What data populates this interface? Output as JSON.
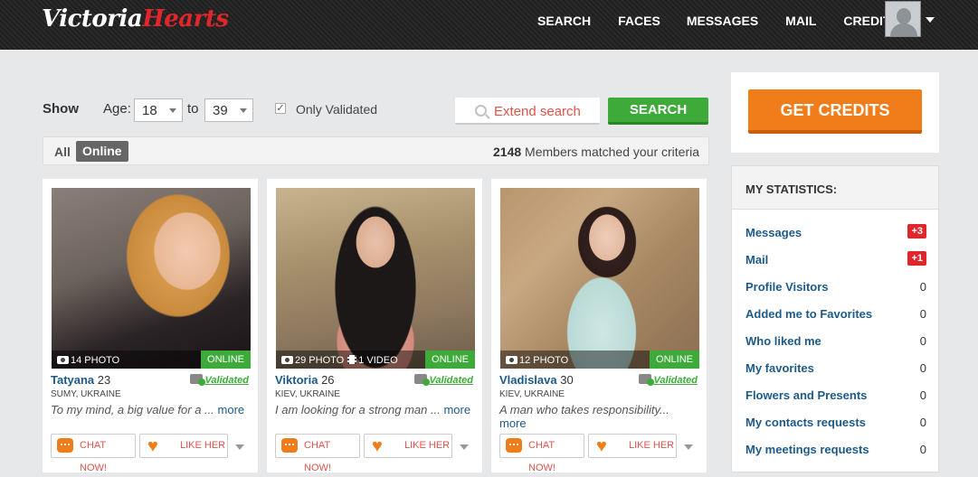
{
  "header": {
    "logo_part1": "Victoria",
    "logo_part2": "Hearts",
    "nav": [
      {
        "label": "SEARCH"
      },
      {
        "label": "FACES"
      },
      {
        "label": "MESSAGES"
      },
      {
        "label": "MAIL"
      },
      {
        "label": "CREDITS"
      }
    ]
  },
  "filter": {
    "show_label": "Show",
    "age_label": "Age:",
    "age_from": "18",
    "to_label": "to",
    "age_to": "39",
    "only_validated_checked": true,
    "only_validated_label": "Only Validated",
    "extend_search_label": "Extend search",
    "search_button": "SEARCH"
  },
  "tabs": {
    "all": "All",
    "online": "Online",
    "matched_count": "2148",
    "matched_text": "Members matched your criteria"
  },
  "cards": [
    {
      "photo_info": "14 PHOTO",
      "video_info": "",
      "online": "ONLINE",
      "name": "Tatyana",
      "age": "23",
      "validated": "Validated",
      "location": "SUMY, UKRAINE",
      "bio": "To my mind, a big value for a ...",
      "more": "more",
      "chat": "CHAT NOW!",
      "like": "LIKE HER"
    },
    {
      "photo_info": "29 PHOTO",
      "video_info": "1 VIDEO",
      "online": "ONLINE",
      "name": "Viktoria",
      "age": "26",
      "validated": "Validated",
      "location": "KIEV, UKRAINE",
      "bio": "I am looking for a strong man ...",
      "more": "more",
      "chat": "CHAT NOW!",
      "like": "LIKE HER"
    },
    {
      "photo_info": "12 PHOTO",
      "video_info": "",
      "online": "ONLINE",
      "name": "Vladislava",
      "age": "30",
      "validated": "Validated",
      "location": "KIEV, UKRAINE",
      "bio": "A man who takes responsibility...",
      "more": "more",
      "chat": "CHAT NOW!",
      "like": "LIKE HER"
    }
  ],
  "sidebar": {
    "get_credits": "GET CREDITS",
    "stats_title": "MY STATISTICS:",
    "stats": [
      {
        "label": "Messages",
        "value": "+3"
      },
      {
        "label": "Mail",
        "value": "+1"
      },
      {
        "label": "Profile Visitors",
        "value": "0"
      },
      {
        "label": "Added me to Favorites",
        "value": "0"
      },
      {
        "label": "Who liked me",
        "value": "0"
      },
      {
        "label": "My favorites",
        "value": "0"
      },
      {
        "label": "Flowers and Presents",
        "value": "0"
      },
      {
        "label": "My contacts requests",
        "value": "0"
      },
      {
        "label": "My meetings requests",
        "value": "0"
      }
    ]
  },
  "colors": {
    "accent_orange": "#f07d1a",
    "green": "#3eaa3a",
    "red": "#e0262b",
    "link_blue": "#1d5a8a"
  }
}
